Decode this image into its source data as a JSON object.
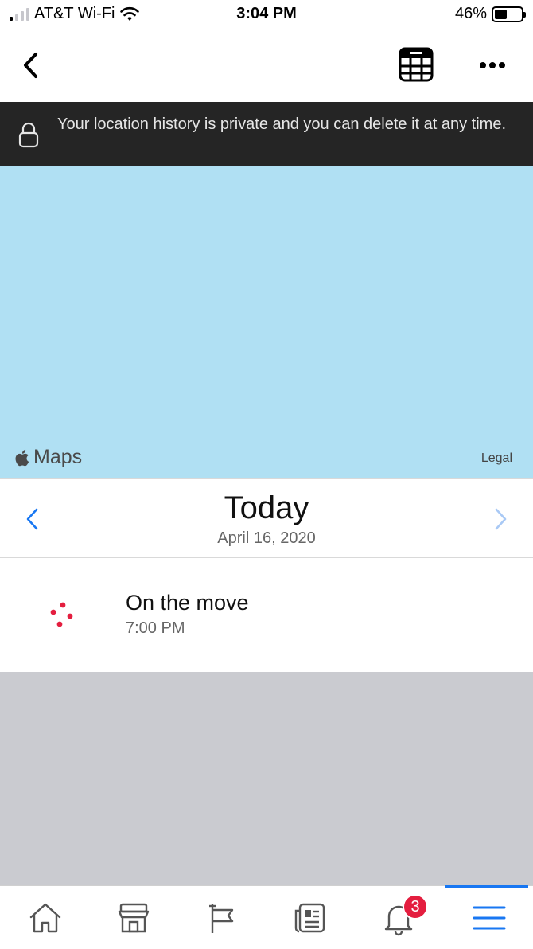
{
  "status_bar": {
    "carrier": "AT&T Wi-Fi",
    "time": "3:04 PM",
    "battery": "46%",
    "battery_level": 0.46
  },
  "nav": {
    "back_icon": "chevron-left-icon",
    "calendar_icon": "calendar-icon",
    "more_icon": "ellipsis-icon"
  },
  "privacy_banner": {
    "icon": "lock-icon",
    "text": "Your location history is private and you can delete it at any time."
  },
  "map": {
    "attribution": "Maps",
    "legal": "Legal",
    "background_color": "#b0e0f3"
  },
  "date_selector": {
    "title": "Today",
    "date": "April 16, 2020",
    "accent_color": "#1877f2"
  },
  "activities": [
    {
      "title": "On the move",
      "time": "7:00 PM",
      "icon": "dots-icon",
      "icon_color": "#e41e3f"
    }
  ],
  "tab_bar": {
    "tabs": [
      {
        "name": "home",
        "icon": "home-icon"
      },
      {
        "name": "marketplace",
        "icon": "marketplace-icon"
      },
      {
        "name": "pages",
        "icon": "flag-icon"
      },
      {
        "name": "news",
        "icon": "news-icon"
      },
      {
        "name": "notifications",
        "icon": "bell-icon",
        "badge": "3"
      },
      {
        "name": "menu",
        "icon": "menu-icon",
        "active": true
      }
    ]
  }
}
